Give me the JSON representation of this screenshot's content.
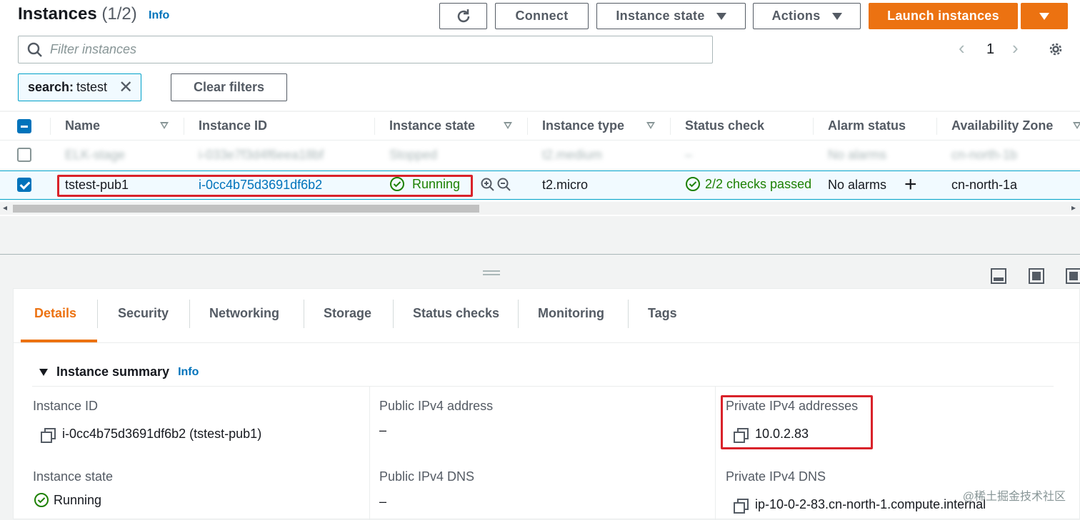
{
  "header": {
    "title": "Instances",
    "count": "(1/2)",
    "info": "Info",
    "refresh_icon": "refresh-icon",
    "connect": "Connect",
    "instance_state": "Instance state",
    "actions": "Actions",
    "launch": "Launch instances"
  },
  "filter": {
    "placeholder": "Filter instances",
    "page": "1",
    "chip_key": "search:",
    "chip_value": "tstest",
    "clear": "Clear filters"
  },
  "columns": [
    "Name",
    "Instance ID",
    "Instance state",
    "Instance type",
    "Status check",
    "Alarm status",
    "Availability Zone"
  ],
  "rows": [
    {
      "name": "ELK-stage",
      "id": "i-033e7f3d4f6eea18bf",
      "state": "Stopped",
      "type": "t2.medium",
      "check": "–",
      "alarm": "No alarms",
      "az": "cn-north-1b",
      "selected": false
    },
    {
      "name": "tstest-pub1",
      "id": "i-0cc4b75d3691df6b2",
      "state": "Running",
      "type": "t2.micro",
      "check": "2/2 checks passed",
      "alarm": "No alarms",
      "az": "cn-north-1a",
      "selected": true
    }
  ],
  "tabs": [
    "Details",
    "Security",
    "Networking",
    "Storage",
    "Status checks",
    "Monitoring",
    "Tags"
  ],
  "summary": {
    "title": "Instance summary",
    "info": "Info",
    "instance_id_label": "Instance ID",
    "instance_id_value": "i-0cc4b75d3691df6b2 (tstest-pub1)",
    "public_ipv4_label": "Public IPv4 address",
    "public_ipv4_value": "–",
    "private_ipv4_label": "Private IPv4 addresses",
    "private_ipv4_value": "10.0.2.83",
    "state_label": "Instance state",
    "state_value": "Running",
    "public_dns_label": "Public IPv4 DNS",
    "public_dns_value": "–",
    "private_dns_label": "Private IPv4 DNS",
    "private_dns_value": "ip-10-0-2-83.cn-north-1.compute.internal"
  },
  "watermark": "@稀土掘金技术社区",
  "colors": {
    "accent": "#ec7211",
    "link": "#0073bb",
    "success": "#1d8102",
    "highlight": "#d9222a"
  }
}
